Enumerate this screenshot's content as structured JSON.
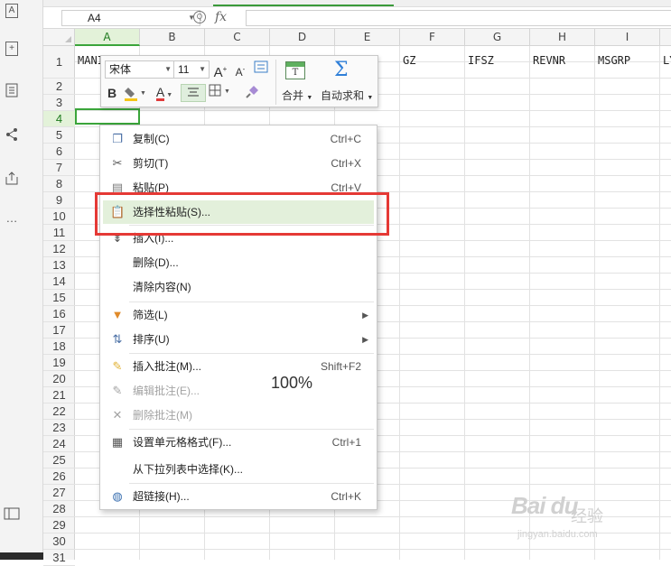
{
  "formula_bar": {
    "name_box": "A4",
    "fx_label": "fx"
  },
  "columns": [
    "A",
    "B",
    "C",
    "D",
    "E",
    "F",
    "G",
    "H",
    "I"
  ],
  "rows": [
    "1",
    "2",
    "3",
    "4",
    "5",
    "6",
    "7",
    "8",
    "9",
    "10",
    "11",
    "12",
    "13",
    "14",
    "15",
    "16",
    "17",
    "18",
    "19",
    "20",
    "21",
    "22",
    "23",
    "24",
    "25",
    "26",
    "27",
    "28",
    "29",
    "30",
    "31"
  ],
  "row1_cells": {
    "A": "MANI",
    "F": "GZ",
    "G": "IFSZ",
    "H": "REVNR",
    "I": "MSGRP",
    "J": "LY"
  },
  "mini_toolbar": {
    "font_name": "宋体",
    "font_size": "11",
    "grow_font": "A",
    "shrink_font": "A",
    "bold": "B",
    "font_color": "A",
    "merge_label": "合并",
    "merge_icon_text": "T",
    "autosum_symbol": "Σ",
    "autosum_label": "自动求和"
  },
  "context_menu": {
    "items": [
      {
        "label": "复制(C)",
        "shortcut": "Ctrl+C",
        "icon": "copy-icon"
      },
      {
        "label": "剪切(T)",
        "shortcut": "Ctrl+X",
        "icon": "scissors-icon"
      },
      {
        "label": "粘贴(P)",
        "shortcut": "Ctrl+V",
        "icon": "clipboard-icon"
      },
      {
        "label": "选择性粘贴(S)...",
        "shortcut": "",
        "icon": "paste-special-icon"
      },
      {
        "label": "插入(I)...",
        "shortcut": "",
        "icon": "insert-rows-icon"
      },
      {
        "label": "删除(D)...",
        "shortcut": "",
        "icon": ""
      },
      {
        "label": "清除内容(N)",
        "shortcut": "",
        "icon": ""
      },
      {
        "label": "筛选(L)",
        "shortcut": "",
        "icon": "funnel-icon"
      },
      {
        "label": "排序(U)",
        "shortcut": "",
        "icon": "sort-icon"
      },
      {
        "label": "插入批注(M)...",
        "shortcut": "Shift+F2",
        "icon": "insert-comment-icon"
      },
      {
        "label": "编辑批注(E)...",
        "shortcut": "",
        "icon": "edit-comment-icon"
      },
      {
        "label": "删除批注(M)",
        "shortcut": "",
        "icon": "delete-comment-icon"
      },
      {
        "label": "设置单元格格式(F)...",
        "shortcut": "Ctrl+1",
        "icon": "format-cells-icon"
      },
      {
        "label": "从下拉列表中选择(K)...",
        "shortcut": "",
        "icon": ""
      },
      {
        "label": "超链接(H)...",
        "shortcut": "Ctrl+K",
        "icon": "globe-link-icon"
      }
    ]
  },
  "zoom_level": "100%",
  "watermark": {
    "logo": "Bai du",
    "text": "经验",
    "url": "jingyan.baidu.com"
  },
  "colors": {
    "selection_green": "#3aa53a",
    "highlight_bg": "#e3f0db",
    "red_frame": "#e53935",
    "autosum_blue": "#2f7fd8"
  }
}
